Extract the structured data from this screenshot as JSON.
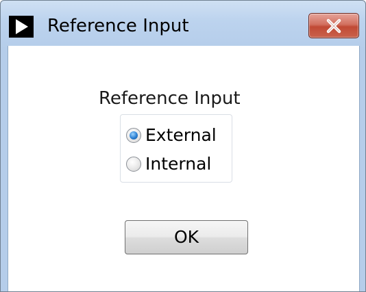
{
  "window": {
    "title": "Reference Input",
    "icon": "play-icon",
    "close_icon": "close-icon"
  },
  "dialog": {
    "group_label": "Reference Input",
    "options": [
      {
        "label": "External",
        "selected": true
      },
      {
        "label": "Internal",
        "selected": false
      }
    ],
    "ok_label": "OK"
  },
  "colors": {
    "close_button": "#c9503b",
    "radio_selected": "#2b7fd2",
    "title_bar": "#bcd3ee"
  }
}
